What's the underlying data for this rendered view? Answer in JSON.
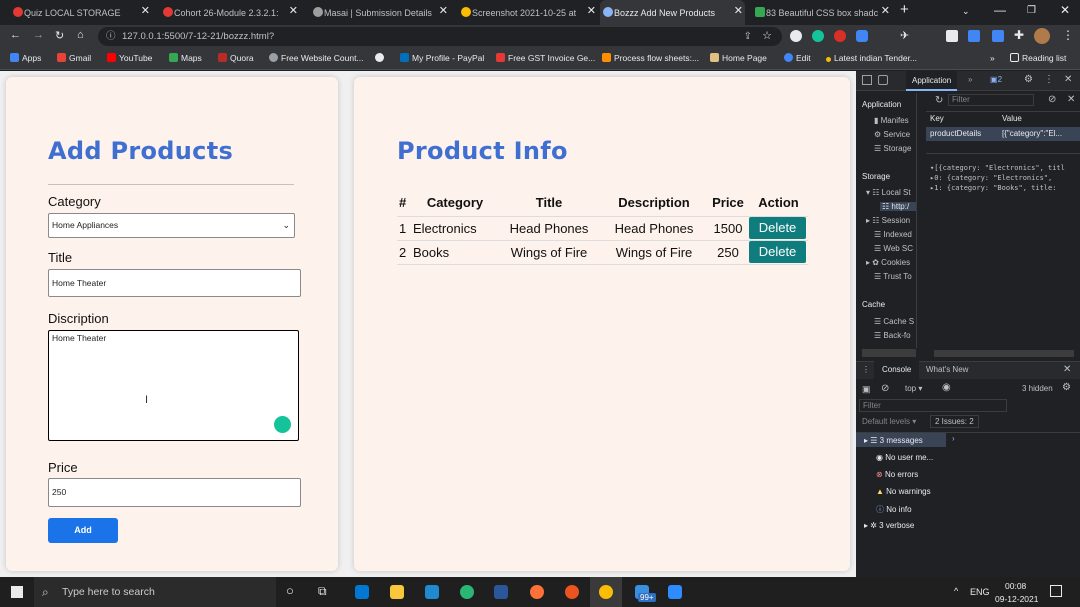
{
  "tabs": [
    {
      "title": "Quiz LOCAL STORAGE",
      "active": false
    },
    {
      "title": "Cohort 26-Module 2.3.2.1:",
      "active": false
    },
    {
      "title": "Masai | Submission Details",
      "active": false
    },
    {
      "title": "Screenshot 2021-10-25 at",
      "active": false
    },
    {
      "title": "Bozzz Add New Products",
      "active": true
    },
    {
      "title": "83 Beautiful CSS box shadc",
      "active": false
    }
  ],
  "address": {
    "url": "127.0.0.1:5500/7-12-21/bozzz.html?"
  },
  "bookmarks": [
    "Apps",
    "Gmail",
    "YouTube",
    "Maps",
    "Quora",
    "Free Website Count...",
    "",
    "My Profile - PayPal",
    "Free GST Invoice Ge...",
    "Process flow sheets:...",
    "Home Page",
    "Edit",
    "Latest indian Tender...",
    "Reading list"
  ],
  "form": {
    "heading": "Add Products",
    "category_label": "Category",
    "category_value": "Home Appliances",
    "title_label": "Title",
    "title_value": "Home Theater",
    "description_label": "Discription",
    "description_value": "Home Theater",
    "price_label": "Price",
    "price_value": "250",
    "add_label": "Add"
  },
  "products": {
    "heading": "Product Info",
    "columns": [
      "#",
      "Category",
      "Title",
      "Description",
      "Price",
      "Action"
    ],
    "rows": [
      {
        "num": "1",
        "category": "Electronics",
        "title": "Head Phones",
        "description": "Head Phones",
        "price": "1500",
        "action": "Delete"
      },
      {
        "num": "2",
        "category": "Books",
        "title": "Wings of Fire",
        "description": "Wings of Fire",
        "price": "250",
        "action": "Delete"
      }
    ]
  },
  "devtools": {
    "tab": "Application",
    "badge": "2",
    "filter_placeholder": "Filter",
    "section_app": "Application",
    "app_items": [
      "Manifes",
      "Service",
      "Storage"
    ],
    "section_storage": "Storage",
    "storage_items": [
      "Local St",
      "http:/",
      "Session",
      "Indexed",
      "Web SC",
      "Cookies",
      "Trust To"
    ],
    "section_cache": "Cache",
    "cache_items": [
      "Cache S",
      "Back-fo"
    ],
    "kv_key": "Key",
    "kv_value": "Value",
    "kv_row_key": "productDetails",
    "kv_row_value": "[{\"category\":\"El...",
    "preview": [
      "▾[{category: \"Electronics\", titl",
      "  ▸0: {category: \"Electronics\", ",
      "  ▸1: {category: \"Books\", title:"
    ],
    "console_tabs": [
      "Console",
      "What's New"
    ],
    "console_context": "top",
    "console_hidden": "3 hidden",
    "console_filter": "Filter",
    "default_levels": "Default levels",
    "issues": "2 Issues: 2",
    "messages": [
      "3 messages",
      "No user me...",
      "No errors",
      "No warnings",
      "No info",
      "3 verbose"
    ]
  },
  "taskbar": {
    "search": "Type here to search",
    "lang": "ENG",
    "time": "00:08",
    "date": "09-12-2021",
    "badge": "99+"
  },
  "colors": {
    "accent_heading": "#3f6fd1",
    "add_button": "#1a73e8",
    "delete_button": "#0f7d7d",
    "card_bg": "#fdf2ec"
  }
}
